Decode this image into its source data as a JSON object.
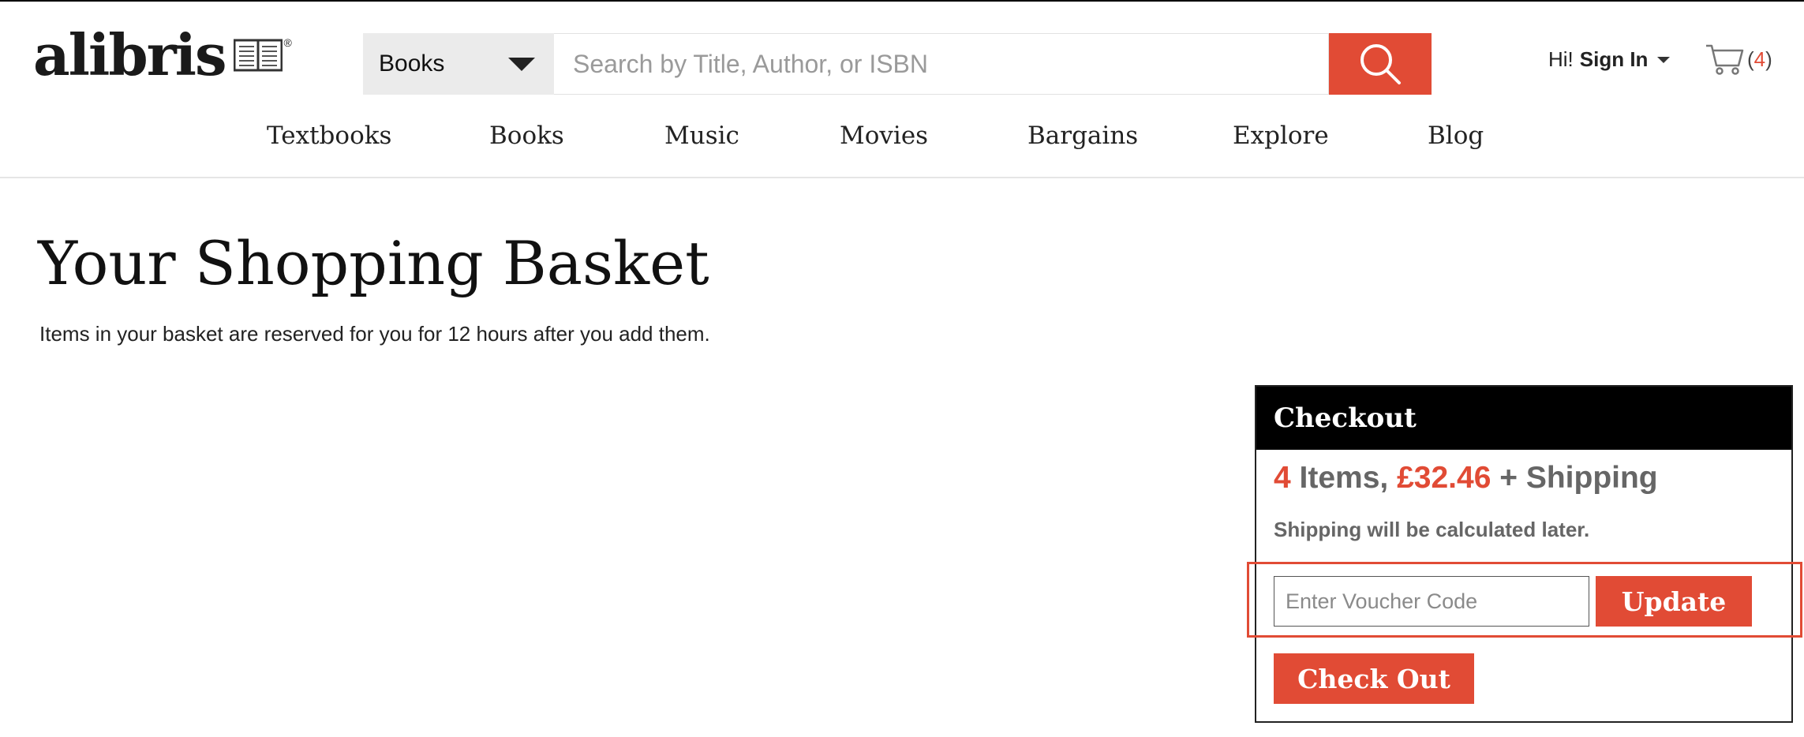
{
  "colors": {
    "accent": "#e14b35",
    "checkout_header": "#000000",
    "muted_text": "#666666"
  },
  "logo": {
    "text": "alibris",
    "reg": "®",
    "icon": "open-book-icon"
  },
  "search": {
    "category": "Books",
    "placeholder": "Search by Title, Author, or ISBN",
    "button_icon": "search-icon"
  },
  "account": {
    "greeting": "Hi!",
    "signin_label": "Sign In"
  },
  "cart": {
    "icon": "cart-icon",
    "open": "(",
    "count": "4",
    "close": ")"
  },
  "nav": {
    "items": [
      {
        "label": "Textbooks"
      },
      {
        "label": "Books"
      },
      {
        "label": "Music"
      },
      {
        "label": "Movies"
      },
      {
        "label": "Bargains"
      },
      {
        "label": "Explore"
      },
      {
        "label": "Blog"
      }
    ]
  },
  "page": {
    "title": "Your Shopping Basket",
    "subtitle": "Items in your basket are reserved for you for 12 hours after you add them."
  },
  "checkout": {
    "header": "Checkout",
    "item_count": "4",
    "items_label": " Items, ",
    "total": "£32.46",
    "shipping_label": " + Shipping",
    "shipping_note": "Shipping will be calculated later.",
    "voucher_placeholder": "Enter Voucher Code",
    "update_label": "Update",
    "checkout_label": "Check Out"
  }
}
